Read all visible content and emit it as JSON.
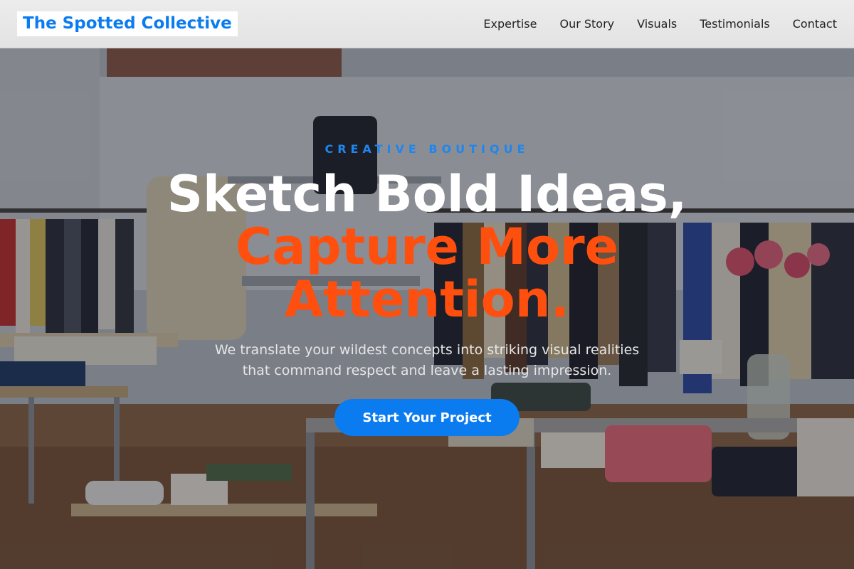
{
  "header": {
    "logo": "The Spotted Collective",
    "nav": [
      "Expertise",
      "Our Story",
      "Visuals",
      "Testimonials",
      "Contact"
    ]
  },
  "hero": {
    "eyebrow": "CREATIVE BOUTIQUE",
    "headline_line1": "Sketch Bold Ideas,",
    "headline_line2": "Capture More",
    "headline_line3": "Attention.",
    "subtitle_line1": "We translate your wildest concepts into striking visual realities",
    "subtitle_line2": "that command respect and leave a lasting impression.",
    "cta_label": "Start Your Project"
  },
  "colors": {
    "brand_blue": "#0a7cf0",
    "accent_orange": "#ff4f0e"
  }
}
